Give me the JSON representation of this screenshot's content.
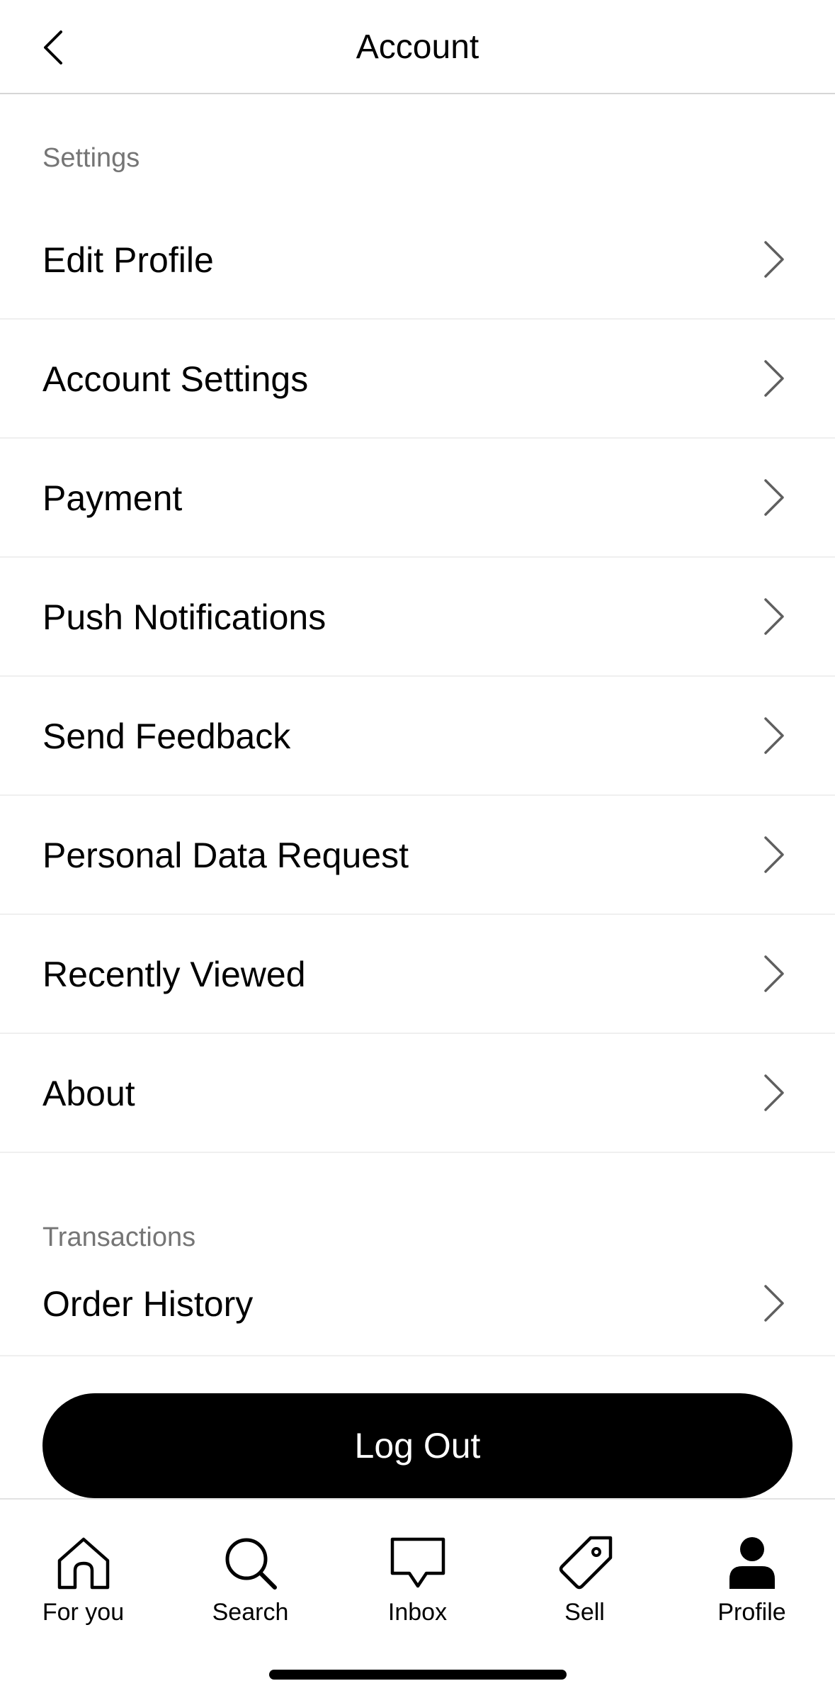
{
  "header": {
    "title": "Account"
  },
  "settings": {
    "section_label": "Settings",
    "items": [
      {
        "label": "Edit Profile"
      },
      {
        "label": "Account Settings"
      },
      {
        "label": "Payment"
      },
      {
        "label": "Push Notifications"
      },
      {
        "label": "Send Feedback"
      },
      {
        "label": "Personal Data Request"
      },
      {
        "label": "Recently Viewed"
      },
      {
        "label": "About"
      }
    ]
  },
  "transactions": {
    "section_label": "Transactions",
    "items": [
      {
        "label": "Order History"
      }
    ]
  },
  "logout": {
    "label": "Log Out"
  },
  "tabbar": {
    "tabs": [
      {
        "label": "For you",
        "icon": "home-icon"
      },
      {
        "label": "Search",
        "icon": "search-icon"
      },
      {
        "label": "Inbox",
        "icon": "inbox-icon"
      },
      {
        "label": "Sell",
        "icon": "tag-icon"
      },
      {
        "label": "Profile",
        "icon": "profile-icon",
        "active": true
      }
    ]
  }
}
